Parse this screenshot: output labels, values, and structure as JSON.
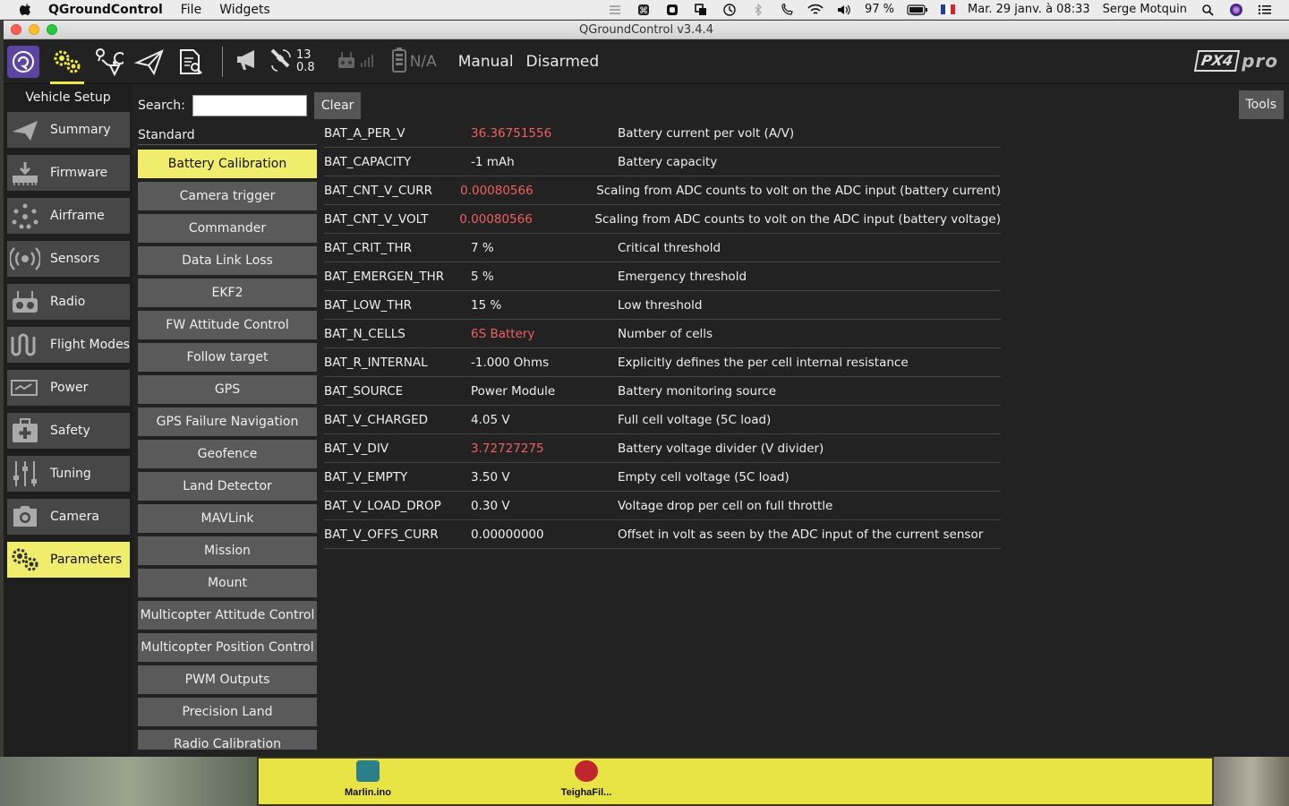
{
  "menubar": {
    "app_name": "QGroundControl",
    "menus": [
      "File",
      "Widgets"
    ],
    "battery_pct": "97 %",
    "datetime": "Mar. 29 janv. à  08:33",
    "user": "Serge Motquin"
  },
  "window": {
    "title": "QGroundControl v3.4.4"
  },
  "toolbar": {
    "satellites": "13",
    "hdop": "0.8",
    "battery": "N/A",
    "flight_mode": "Manual",
    "arm_state": "Disarmed",
    "brand": "PX4",
    "brand_suffix": "pro"
  },
  "sidebar": {
    "header": "Vehicle Setup",
    "items": [
      {
        "label": "Summary"
      },
      {
        "label": "Firmware"
      },
      {
        "label": "Airframe"
      },
      {
        "label": "Sensors"
      },
      {
        "label": "Radio"
      },
      {
        "label": "Flight Modes"
      },
      {
        "label": "Power"
      },
      {
        "label": "Safety"
      },
      {
        "label": "Tuning"
      },
      {
        "label": "Camera"
      },
      {
        "label": "Parameters"
      }
    ]
  },
  "search": {
    "label": "Search:",
    "value": "",
    "clear_label": "Clear"
  },
  "tools_label": "Tools",
  "group_heading": "Standard",
  "groups": [
    "Battery Calibration",
    "Camera trigger",
    "Commander",
    "Data Link Loss",
    "EKF2",
    "FW Attitude Control",
    "Follow target",
    "GPS",
    "GPS Failure Navigation",
    "Geofence",
    "Land Detector",
    "MAVLink",
    "Mission",
    "Mount",
    "Multicopter Attitude Control",
    "Multicopter Position Control",
    "PWM Outputs",
    "Precision Land",
    "Radio Calibration"
  ],
  "parameters": [
    {
      "name": "BAT_A_PER_V",
      "value": "36.36751556",
      "modified": true,
      "desc": "Battery current per volt (A/V)"
    },
    {
      "name": "BAT_CAPACITY",
      "value": "-1 mAh",
      "modified": false,
      "desc": "Battery capacity"
    },
    {
      "name": "BAT_CNT_V_CURR",
      "value": "0.00080566",
      "modified": true,
      "desc": "Scaling from ADC counts to volt on the ADC input (battery current)"
    },
    {
      "name": "BAT_CNT_V_VOLT",
      "value": "0.00080566",
      "modified": true,
      "desc": "Scaling from ADC counts to volt on the ADC input (battery voltage)"
    },
    {
      "name": "BAT_CRIT_THR",
      "value": "7 %",
      "modified": false,
      "desc": "Critical threshold"
    },
    {
      "name": "BAT_EMERGEN_THR",
      "value": "5 %",
      "modified": false,
      "desc": "Emergency threshold"
    },
    {
      "name": "BAT_LOW_THR",
      "value": "15 %",
      "modified": false,
      "desc": "Low threshold"
    },
    {
      "name": "BAT_N_CELLS",
      "value": "6S Battery",
      "modified": true,
      "desc": "Number of cells"
    },
    {
      "name": "BAT_R_INTERNAL",
      "value": "-1.000 Ohms",
      "modified": false,
      "desc": "Explicitly defines the per cell internal resistance"
    },
    {
      "name": "BAT_SOURCE",
      "value": "Power Module",
      "modified": false,
      "desc": "Battery monitoring source"
    },
    {
      "name": "BAT_V_CHARGED",
      "value": "4.05 V",
      "modified": false,
      "desc": "Full cell voltage (5C load)"
    },
    {
      "name": "BAT_V_DIV",
      "value": "3.72727275",
      "modified": true,
      "desc": "Battery voltage divider (V divider)"
    },
    {
      "name": "BAT_V_EMPTY",
      "value": "3.50 V",
      "modified": false,
      "desc": "Empty cell voltage (5C load)"
    },
    {
      "name": "BAT_V_LOAD_DROP",
      "value": "0.30 V",
      "modified": false,
      "desc": "Voltage drop per cell on full throttle"
    },
    {
      "name": "BAT_V_OFFS_CURR",
      "value": "0.00000000",
      "modified": false,
      "desc": "Offset in volt as seen by the ADC input of the current sensor"
    }
  ],
  "dock_files": [
    "Marlin.ino",
    "TeighaFil..."
  ],
  "colors": {
    "accent": "#f0ec6c",
    "modified_value": "#f06060",
    "panel": "#222222",
    "button": "#5a5a5a"
  }
}
